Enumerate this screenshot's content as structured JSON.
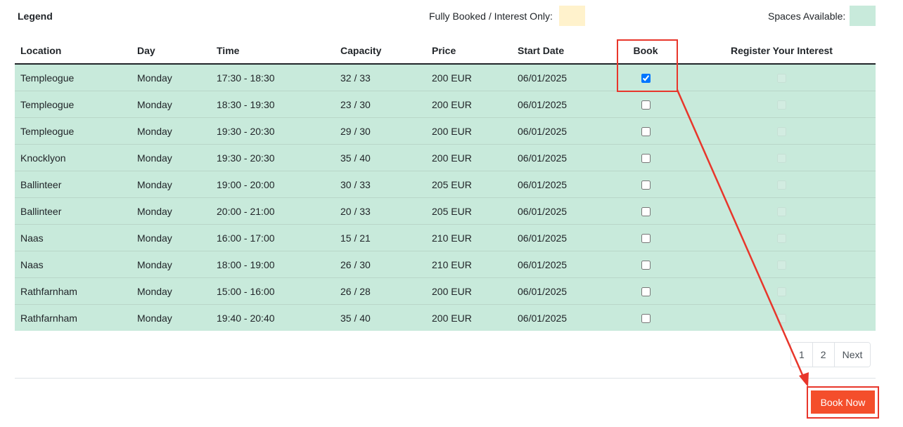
{
  "colors": {
    "fully_booked": "#fff2cc",
    "available": "#c8eadb",
    "accent": "#f44e2b",
    "annotation": "#e8362b"
  },
  "legend": {
    "title": "Legend",
    "fully_booked_label": "Fully Booked / Interest Only:",
    "available_label": "Spaces Available:"
  },
  "table": {
    "headers": [
      "Location",
      "Day",
      "Time",
      "Capacity",
      "Price",
      "Start Date",
      "Book",
      "Register Your Interest"
    ],
    "rows": [
      {
        "location": "Templeogue",
        "day": "Monday",
        "time": "17:30 - 18:30",
        "capacity": "32 / 33",
        "price": "200 EUR",
        "start_date": "06/01/2025",
        "book_checked": true
      },
      {
        "location": "Templeogue",
        "day": "Monday",
        "time": "18:30 - 19:30",
        "capacity": "23 / 30",
        "price": "200 EUR",
        "start_date": "06/01/2025",
        "book_checked": false
      },
      {
        "location": "Templeogue",
        "day": "Monday",
        "time": "19:30 - 20:30",
        "capacity": "29 / 30",
        "price": "200 EUR",
        "start_date": "06/01/2025",
        "book_checked": false
      },
      {
        "location": "Knocklyon",
        "day": "Monday",
        "time": "19:30 - 20:30",
        "capacity": "35 / 40",
        "price": "200 EUR",
        "start_date": "06/01/2025",
        "book_checked": false
      },
      {
        "location": "Ballinteer",
        "day": "Monday",
        "time": "19:00 - 20:00",
        "capacity": "30 / 33",
        "price": "205 EUR",
        "start_date": "06/01/2025",
        "book_checked": false
      },
      {
        "location": "Ballinteer",
        "day": "Monday",
        "time": "20:00 - 21:00",
        "capacity": "20 / 33",
        "price": "205 EUR",
        "start_date": "06/01/2025",
        "book_checked": false
      },
      {
        "location": "Naas",
        "day": "Monday",
        "time": "16:00 - 17:00",
        "capacity": "15 / 21",
        "price": "210 EUR",
        "start_date": "06/01/2025",
        "book_checked": false
      },
      {
        "location": "Naas",
        "day": "Monday",
        "time": "18:00 - 19:00",
        "capacity": "26 / 30",
        "price": "210 EUR",
        "start_date": "06/01/2025",
        "book_checked": false
      },
      {
        "location": "Rathfarnham",
        "day": "Monday",
        "time": "15:00 - 16:00",
        "capacity": "26 / 28",
        "price": "200 EUR",
        "start_date": "06/01/2025",
        "book_checked": false
      },
      {
        "location": "Rathfarnham",
        "day": "Monday",
        "time": "19:40 - 20:40",
        "capacity": "35 / 40",
        "price": "200 EUR",
        "start_date": "06/01/2025",
        "book_checked": false
      }
    ]
  },
  "pagination": [
    "1",
    "2",
    "Next"
  ],
  "book_now_label": "Book Now"
}
